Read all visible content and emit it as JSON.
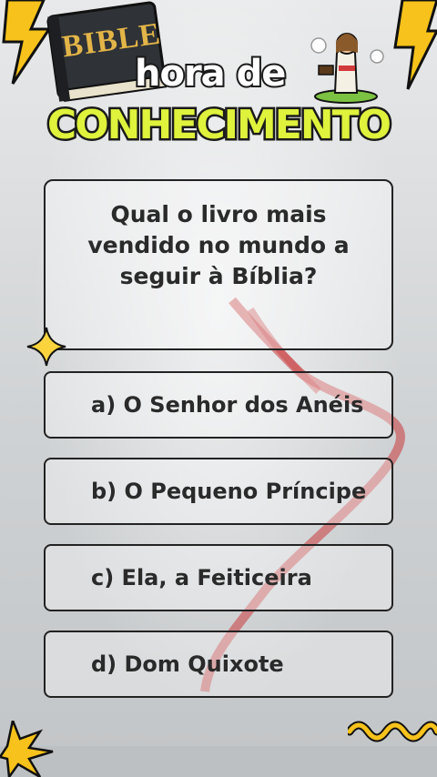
{
  "header": {
    "logo_word": "BIBLE",
    "title_line1": "hora de",
    "title_line2": "CONHECIMENTO"
  },
  "quiz": {
    "question": "Qual o livro mais vendido no mundo a seguir à Bíblia?",
    "options": [
      {
        "label": "a) O Senhor dos Anéis"
      },
      {
        "label": "b) O Pequeno Príncipe"
      },
      {
        "label": "c) Ela, a Feiticeira"
      },
      {
        "label": "d) Dom Quixote"
      }
    ]
  },
  "colors": {
    "title_accent": "#dff23c",
    "lightning": "#f6c21b",
    "ribbon": "#c8383a"
  },
  "icons": [
    "bible-book-icon",
    "jesus-character-icon",
    "lightning-bolt-icon",
    "sparkle-star-icon",
    "zigzag-wave-icon",
    "starburst-icon"
  ]
}
